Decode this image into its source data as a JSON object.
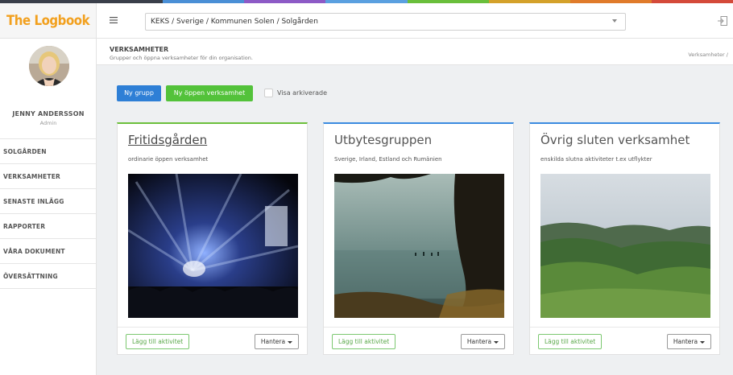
{
  "brand": {
    "name": "The Logbook"
  },
  "header": {
    "org_path": "KEKS / Sverige / Kommunen Solen / Solgården",
    "stripe_colors": [
      "#3a3f4a",
      "#4a8fd6",
      "#8d5ac6",
      "#5aa0e0",
      "#6abf3b",
      "#d4a12a",
      "#e07b2a",
      "#d44a3a"
    ]
  },
  "user": {
    "name": "JENNY ANDERSSON",
    "role": "Admin"
  },
  "nav": {
    "items": [
      {
        "label": "SOLGÅRDEN"
      },
      {
        "label": "VERKSAMHETER"
      },
      {
        "label": "SENASTE INLÄGG"
      },
      {
        "label": "RAPPORTER"
      },
      {
        "label": "VÅRA DOKUMENT"
      },
      {
        "label": "ÖVERSÄTTNING"
      }
    ]
  },
  "page": {
    "title": "VERKSAMHETER",
    "subtitle": "Grupper och öppna verksamheter för din organisation.",
    "breadcrumb": "Verksamheter /"
  },
  "toolbar": {
    "new_group": "Ny grupp",
    "new_open": "Ny öppen verksamhet",
    "show_archived": "Visa arkiverade"
  },
  "cards": [
    {
      "title": "Fritidsgården",
      "description": "ordinarie öppen verksamhet",
      "add_label": "Lägg till aktivitet",
      "manage_label": "Hantera",
      "accent": "#6cbf3b"
    },
    {
      "title": "Utbytesgruppen",
      "description": "Sverige, Irland, Estland och Rumänien",
      "add_label": "Lägg till aktivitet",
      "manage_label": "Hantera",
      "accent": "#3b8be0"
    },
    {
      "title": "Övrig sluten verksamhet",
      "description": "enskilda slutna aktiviteter t.ex utflykter",
      "add_label": "Lägg till aktivitet",
      "manage_label": "Hantera",
      "accent": "#3b8be0"
    }
  ]
}
